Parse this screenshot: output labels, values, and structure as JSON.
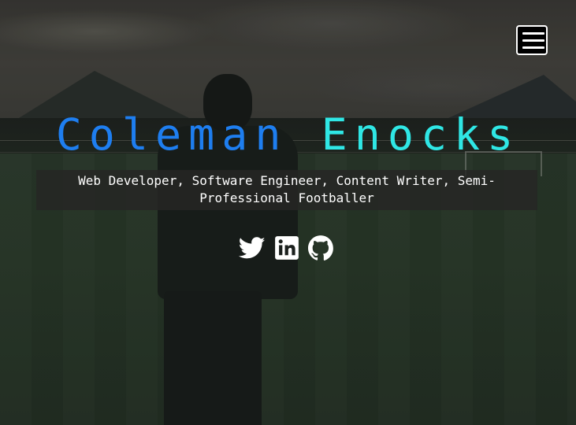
{
  "header": {
    "menu_icon": "hamburger-menu-icon"
  },
  "hero": {
    "first_name": "Coleman",
    "last_name": "Enocks",
    "tagline": "Web Developer, Software Engineer, Content Writer, Semi-Professional Footballer"
  },
  "social": [
    {
      "icon": "twitter-icon"
    },
    {
      "icon": "linkedin-icon"
    },
    {
      "icon": "github-icon"
    }
  ],
  "colors": {
    "first_name": "#1e7ef0",
    "last_name": "#2fe7e5",
    "tagline_text": "#ffffff",
    "tagline_background": "#262624",
    "menu_background": "#000000"
  }
}
